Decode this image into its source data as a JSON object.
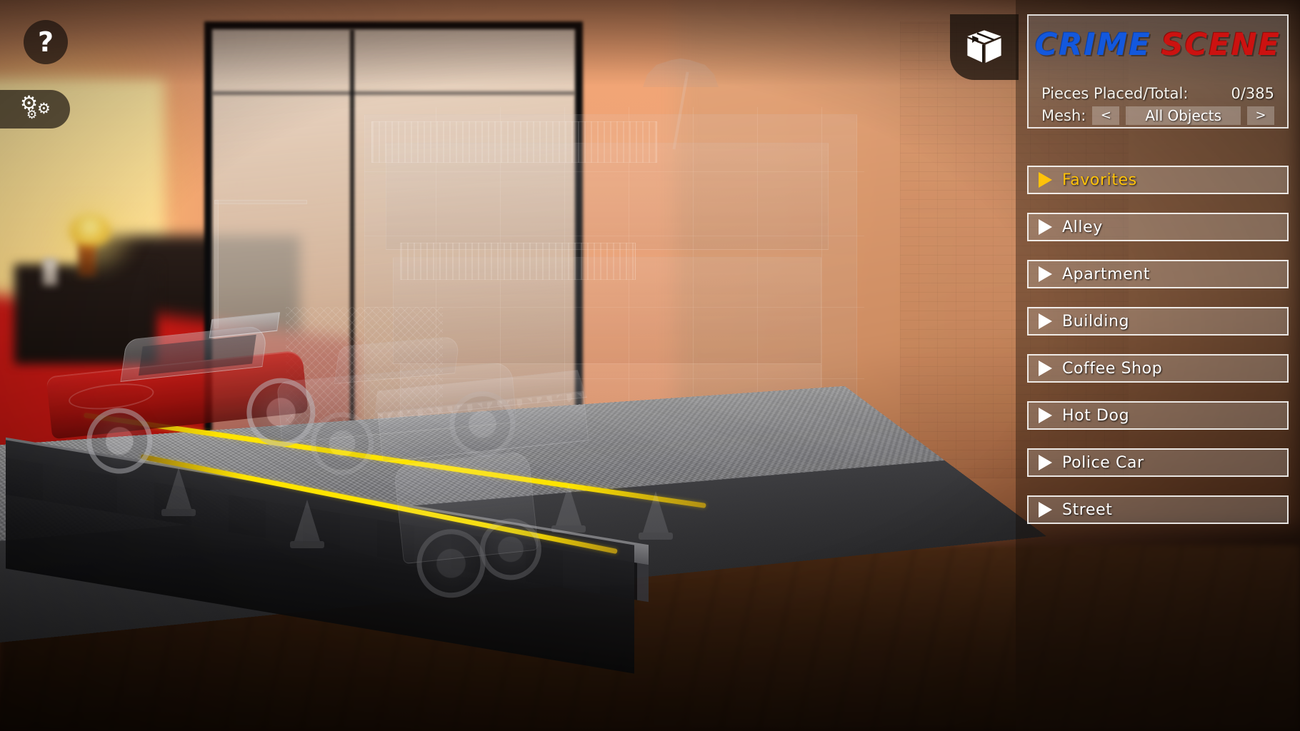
{
  "app": {
    "title_part1": "CRIME",
    "title_part2": "SCENE"
  },
  "hud": {
    "help_label": "?",
    "help_icon": "question-mark-icon",
    "settings_icon": "gears-icon",
    "inventory_icon": "box-icon"
  },
  "stats": {
    "pieces_label": "Pieces Placed/Total:",
    "pieces_value": "0/385"
  },
  "mesh": {
    "label": "Mesh:",
    "prev": "<",
    "next": ">",
    "value": "All Objects"
  },
  "categories": [
    {
      "label": "Favorites",
      "selected": true
    },
    {
      "label": "Alley",
      "selected": false
    },
    {
      "label": "Apartment",
      "selected": false
    },
    {
      "label": "Building",
      "selected": false
    },
    {
      "label": "Coffee Shop",
      "selected": false
    },
    {
      "label": "Hot Dog",
      "selected": false
    },
    {
      "label": "Police Car",
      "selected": false
    },
    {
      "label": "Street",
      "selected": false
    }
  ],
  "colors": {
    "title_blue": "#1358dd",
    "title_red": "#cc1210",
    "selected_accent": "#ffc20a",
    "panel_border": "#ffffff",
    "road_line": "#ffe400"
  }
}
